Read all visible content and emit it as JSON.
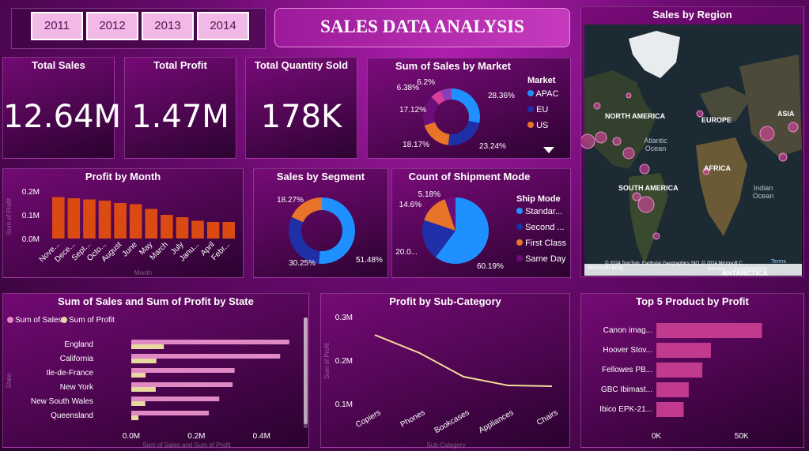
{
  "years": [
    "2011",
    "2012",
    "2013",
    "2014"
  ],
  "title": "SALES DATA ANALYSIS",
  "kpis": [
    {
      "label": "Total Sales",
      "value": "12.64M"
    },
    {
      "label": "Total Profit",
      "value": "1.47M"
    },
    {
      "label": "Total Quantity Sold",
      "value": "178K"
    }
  ],
  "colors": {
    "blue": "#1e90ff",
    "navy": "#1f2fa8",
    "orange": "#e8742a",
    "purple": "#6a0f7a",
    "magenta": "#c94aa0",
    "pink": "#d97bb8",
    "lightpink": "#e88fd0",
    "bar": "#dc4a14",
    "sales": "#e089c4",
    "profit": "#e8d9a0",
    "product": "#c23a8e",
    "line": "#f3dc9a"
  },
  "chart_data": [
    {
      "type": "pie",
      "title": "Sum of Sales by Market",
      "legend_title": "Market",
      "legend": [
        "APAC",
        "EU",
        "US"
      ],
      "slices": [
        {
          "name": "APAC",
          "label": "28.36%",
          "value": 28.36,
          "color": "#1e90ff"
        },
        {
          "name": "EU",
          "label": "23.24%",
          "value": 23.24,
          "color": "#1f2fa8"
        },
        {
          "name": "US",
          "label": "18.17%",
          "value": 18.17,
          "color": "#e8742a"
        },
        {
          "name": "",
          "label": "17.12%",
          "value": 17.12,
          "color": "#6a0f7a"
        },
        {
          "name": "",
          "label": "6.38%",
          "value": 6.38,
          "color": "#d93e9c"
        },
        {
          "name": "",
          "label": "6.2%",
          "value": 6.2,
          "color": "#8a3fb8"
        }
      ]
    },
    {
      "type": "bar",
      "title": "Profit by Month",
      "xlabel": "Month",
      "ylabel": "Sum of Profit",
      "categories": [
        "Nove...",
        "Dece...",
        "Sept...",
        "Octo...",
        "August",
        "June",
        "May",
        "March",
        "July",
        "Janu...",
        "April",
        "Febr..."
      ],
      "values": [
        0.175,
        0.17,
        0.165,
        0.16,
        0.15,
        0.145,
        0.125,
        0.1,
        0.09,
        0.075,
        0.07,
        0.07
      ],
      "ylim": [
        0,
        0.2
      ],
      "ticks": [
        "0.0M",
        "0.1M",
        "0.2M"
      ]
    },
    {
      "type": "pie",
      "title": "Sales by Segment",
      "slices": [
        {
          "label": "51.48%",
          "value": 51.48,
          "color": "#1e90ff"
        },
        {
          "label": "30.25%",
          "value": 30.25,
          "color": "#1f2fa8"
        },
        {
          "label": "18.27%",
          "value": 18.27,
          "color": "#e8742a"
        }
      ]
    },
    {
      "type": "pie",
      "title": "Count of Shipment Mode",
      "legend_title": "Ship Mode",
      "legend": [
        "Standar...",
        "Second ...",
        "First Class",
        "Same Day"
      ],
      "slices": [
        {
          "name": "Standar...",
          "label": "60.19%",
          "value": 60.19,
          "color": "#1e90ff"
        },
        {
          "name": "Second ...",
          "label": "20.0...",
          "value": 20.0,
          "color": "#1f2fa8"
        },
        {
          "name": "First Class",
          "label": "14.6%",
          "value": 14.6,
          "color": "#e8742a"
        },
        {
          "name": "Same Day",
          "label": "5.18%",
          "value": 5.18,
          "color": "#6a0f7a"
        }
      ]
    },
    {
      "type": "bar",
      "title": "Sum of Sales and Sum of Profit by State",
      "legend": [
        "Sum of Sales",
        "Sum of Profit"
      ],
      "xlabel": "Sum of Sales and Sum of Profit",
      "ylabel": "State",
      "categories": [
        "England",
        "California",
        "Ile-de-France",
        "New York",
        "New South Wales",
        "Queensland"
      ],
      "series": [
        {
          "name": "Sum of Sales",
          "values": [
            0.485,
            0.457,
            0.317,
            0.311,
            0.27,
            0.238
          ]
        },
        {
          "name": "Sum of Profit",
          "values": [
            0.1,
            0.077,
            0.044,
            0.075,
            0.043,
            0.022
          ]
        }
      ],
      "ticks": [
        "0.0M",
        "0.2M",
        "0.4M"
      ],
      "xlim": [
        0,
        0.5
      ]
    },
    {
      "type": "line",
      "title": "Profit by Sub-Category",
      "xlabel": "Sub-Category",
      "ylabel": "Sum of Profit",
      "categories": [
        "Copiers",
        "Phones",
        "Bookcases",
        "Appliances",
        "Chairs"
      ],
      "values": [
        0.258,
        0.217,
        0.162,
        0.142,
        0.14
      ],
      "ylim": [
        0.1,
        0.3
      ],
      "ticks": [
        "0.1M",
        "0.2M",
        "0.3M"
      ]
    },
    {
      "type": "bar",
      "title": "Top 5 Product by Profit",
      "categories": [
        "Canon imag...",
        "Hoover Stov...",
        "Fellowes PB...",
        "GBC Ibimast...",
        "Ibico EPK-21..."
      ],
      "values": [
        62,
        32,
        27,
        19,
        16
      ],
      "xlim": [
        0,
        75
      ],
      "ticks": [
        "0K",
        "50K"
      ]
    }
  ],
  "map": {
    "title": "Sales by Region",
    "labels": [
      "NORTH AMERICA",
      "EUROPE",
      "ASIA",
      "Atlantic Ocean",
      "AFRICA",
      "SOUTH AMERICA",
      "Indian Ocean",
      "ANTARCTICA"
    ],
    "attribution": "© 2024 TomTom, Earthstar Geographics SIO, © 2024 Microsoft Corporation, © OpenStreetMap",
    "terms": "Terms",
    "brand": "Microsoft Bing"
  }
}
